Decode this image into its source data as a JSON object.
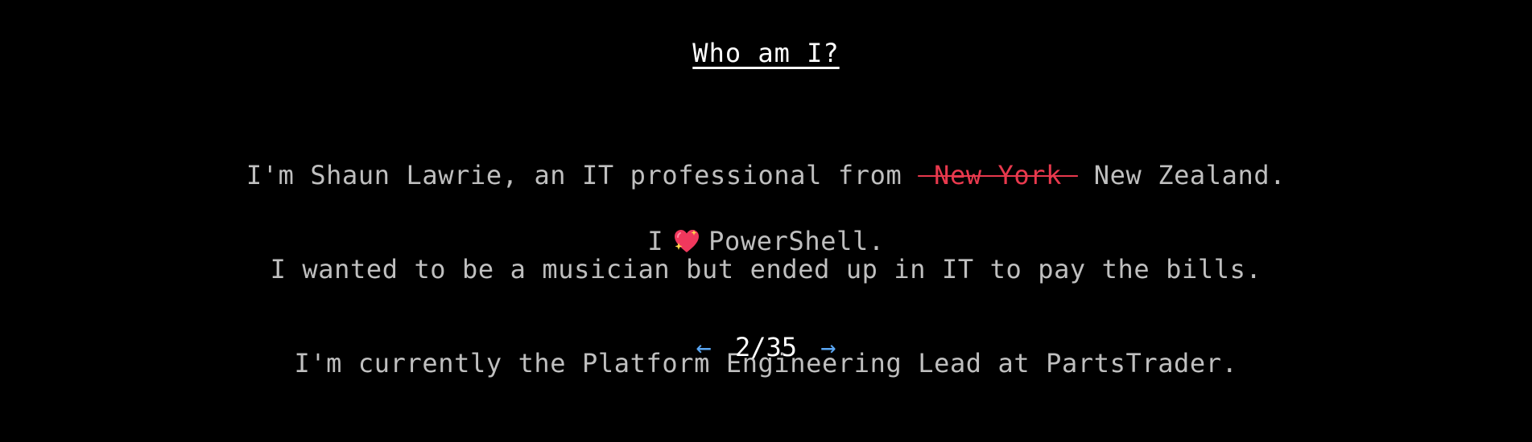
{
  "slide": {
    "title": "Who am I?",
    "bio_line1_before": "I'm Shaun Lawrie, an IT professional from ",
    "bio_line1_struck": " New York ",
    "bio_line1_after": " New Zealand.",
    "bio_line2": "I wanted to be a musician but ended up in IT to pay the bills.",
    "bio_line3": "I'm currently the Platform Engineering Lead at PartsTrader.",
    "love_before": "I",
    "love_icon": "sparkling-heart-icon",
    "love_after": "PowerShell."
  },
  "pager": {
    "prev_label": "←",
    "counter": "2/35",
    "next_label": "→"
  },
  "colors": {
    "background": "#000000",
    "text": "#bfbfbf",
    "title": "#ffffff",
    "struck": "#e8394d",
    "arrow": "#5aa7f5",
    "heart": "#f0385d"
  }
}
